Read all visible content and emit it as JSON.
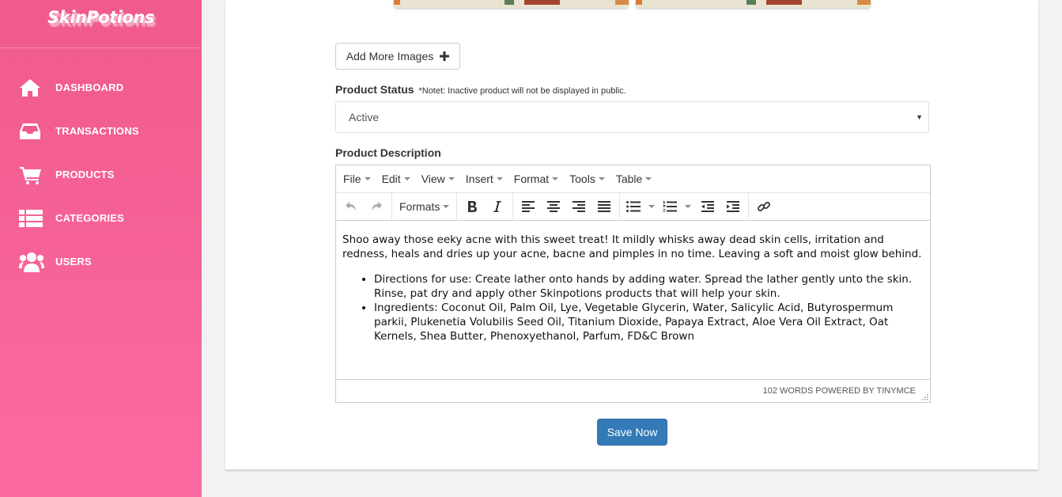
{
  "brand": {
    "name": "SkinPotions"
  },
  "sidebar": {
    "items": [
      {
        "label": "DASHBOARD",
        "icon": "home-icon"
      },
      {
        "label": "TRANSACTIONS",
        "icon": "inbox-icon"
      },
      {
        "label": "PRODUCTS",
        "icon": "shopping-cart-icon"
      },
      {
        "label": "CATEGORIES",
        "icon": "list-icon"
      },
      {
        "label": "USERS",
        "icon": "users-icon"
      }
    ]
  },
  "form": {
    "add_images_label": "Add More Images",
    "status_label": "Product Status",
    "status_note": "*Notet: Inactive product will not be displayed in public.",
    "status_value": "Active",
    "description_label": "Product Description",
    "save_label": "Save Now"
  },
  "editor": {
    "menus": [
      "File",
      "Edit",
      "View",
      "Insert",
      "Format",
      "Tools",
      "Table"
    ],
    "formats_label": "Formats",
    "paragraph": "Shoo away those eeky acne with this sweet treat! It mildly whisks away dead skin cells, irritation and redness, heals and dries up your acne, bacne and pimples in no time. Leaving a soft and moist glow behind.",
    "bullets": [
      "Directions for use: Create lather onto hands by adding water. Spread the lather gently unto the skin. Rinse, pat dry and apply other Skinpotions products that will help your skin.",
      "Ingredients: Coconut Oil, Palm Oil, Lye, Vegetable Glycerin, Water, Salicylic Acid, Butyrospermum parkii, Plukenetia Volubilis Seed Oil, Titanium Dioxide, Papaya Extract, Aloe Vera Oil Extract, Oat Kernels, Shea Butter, Phenoxyethanol, Parfum, FD&C Brown"
    ],
    "status_text": "102 WORDS POWERED BY TINYMCE"
  },
  "colors": {
    "sidebar": "#f05a8d",
    "primary_button": "#337ab7"
  }
}
